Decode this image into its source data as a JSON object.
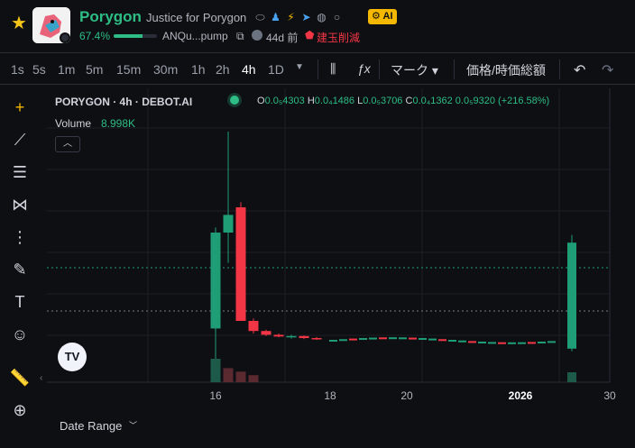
{
  "header": {
    "token_name": "Porygon",
    "token_subtitle": "Justice for Porygon",
    "ai_badge": "AI",
    "bonding_pct_text": "67.4%",
    "bonding_progress": 0.674,
    "address": "ANQu...pump",
    "age": "44d 前",
    "warning": "建玉削減",
    "icons": [
      "pill-icon",
      "people-icon",
      "bolt-icon",
      "telegram-icon",
      "globe-icon",
      "search-icon"
    ]
  },
  "toolbar": {
    "timeframes": [
      "1s",
      "5s",
      "1m",
      "5m",
      "15m",
      "30m",
      "1h",
      "2h",
      "4h",
      "1D"
    ],
    "active_timeframe": "4h",
    "marks_label": "マーク",
    "price_label": "価格/時価総額"
  },
  "legend": {
    "title": "PORYGON · 4h · DEBOT.AI",
    "o_label": "O",
    "o_val": "0.0₅4303",
    "h_label": "H",
    "h_val": "0.0₄1486",
    "l_label": "L",
    "l_val": "0.0₅3706",
    "c_label": "C",
    "c_val": "0.0₄1362",
    "change": "0.0₅9320 (+216.58%)",
    "volume_label": "Volume",
    "volume_val": "8.998K"
  },
  "chart_data": {
    "type": "candlestick",
    "xaxis_ticks": [
      "16",
      "18",
      "20",
      "2026",
      "30"
    ],
    "colors": {
      "up": "#1f9e76",
      "down": "#f23645"
    },
    "candles": [
      {
        "o": 0.12,
        "h": 0.52,
        "l": 0.0,
        "c": 0.5
      },
      {
        "o": 0.5,
        "h": 0.9,
        "l": 0.38,
        "c": 0.57
      },
      {
        "o": 0.6,
        "h": 0.62,
        "l": 0.15,
        "c": 0.15
      },
      {
        "o": 0.15,
        "h": 0.16,
        "l": 0.1,
        "c": 0.11
      },
      {
        "o": 0.11,
        "h": 0.115,
        "l": 0.09,
        "c": 0.095
      },
      {
        "o": 0.095,
        "h": 0.1,
        "l": 0.085,
        "c": 0.088
      },
      {
        "o": 0.088,
        "h": 0.095,
        "l": 0.08,
        "c": 0.09
      },
      {
        "o": 0.09,
        "h": 0.092,
        "l": 0.078,
        "c": 0.082
      },
      {
        "o": 0.082,
        "h": 0.086,
        "l": 0.075,
        "c": 0.078
      }
    ],
    "volumes": [
      1.0,
      0.6,
      0.45,
      0.3
    ]
  },
  "footer": {
    "date_range_label": "Date Range"
  }
}
